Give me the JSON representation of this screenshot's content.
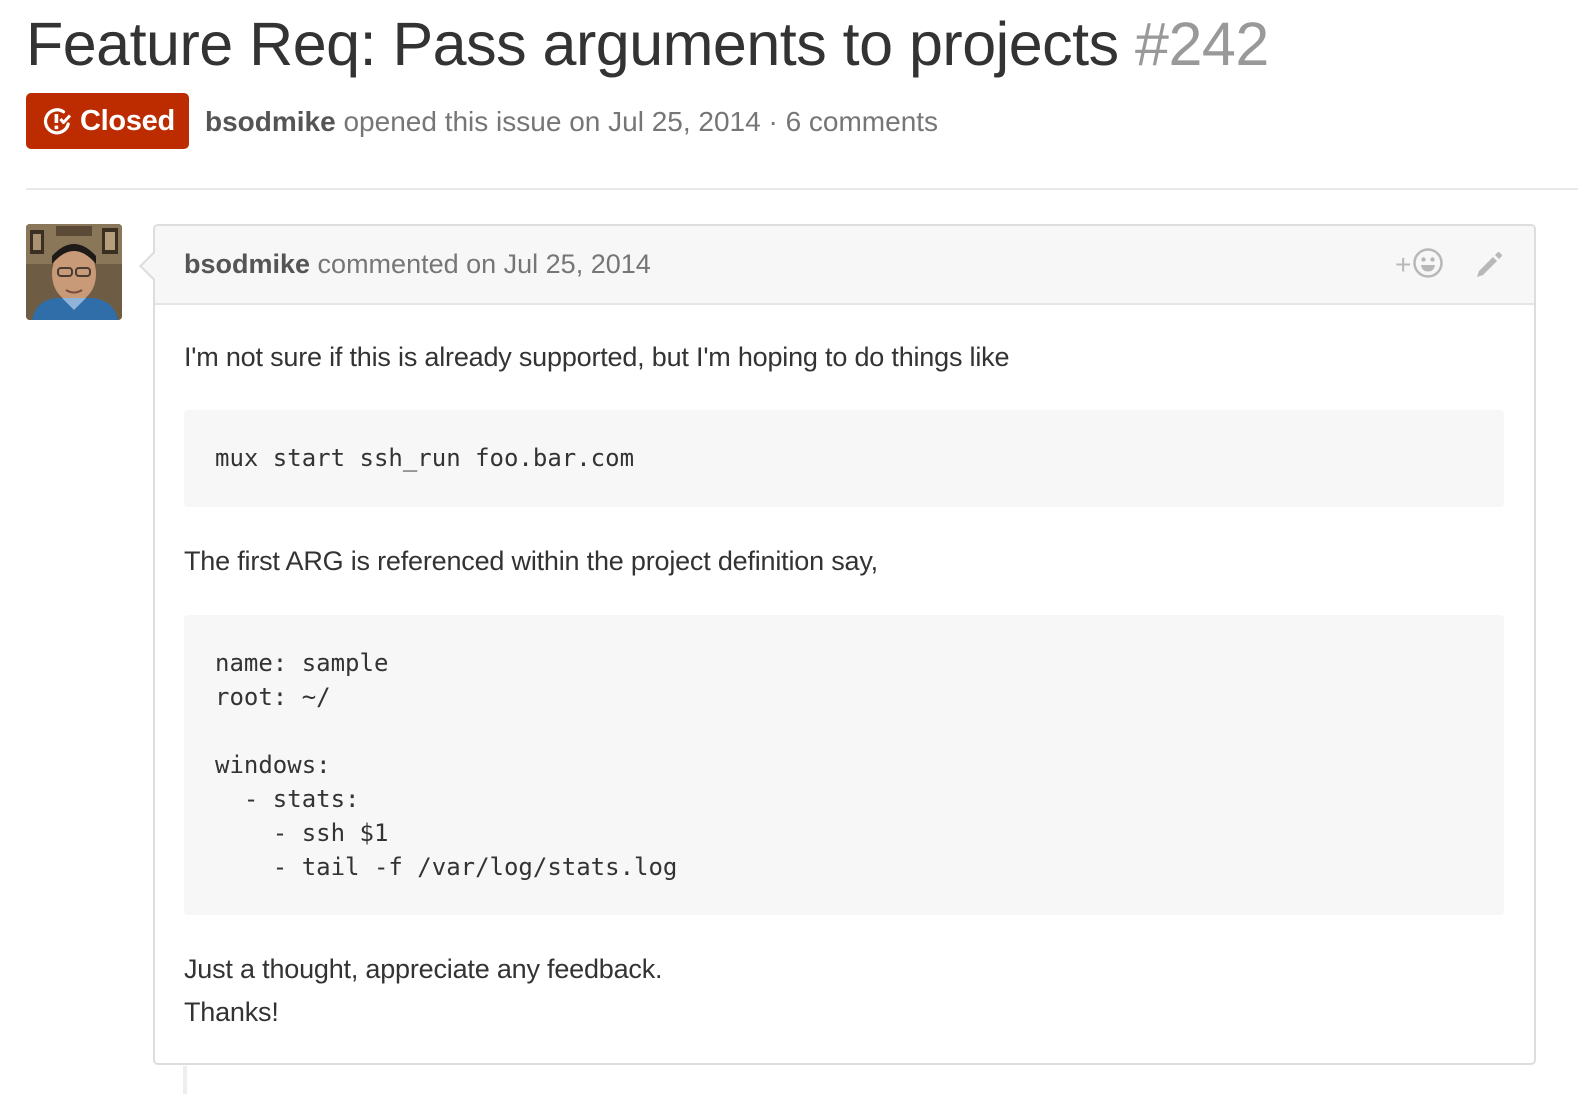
{
  "issue": {
    "title": "Feature Req: Pass arguments to projects",
    "number": "#242",
    "state": "Closed",
    "author": "bsodmike",
    "opened_text": " opened this issue on Jul 25, 2014 · 6 comments"
  },
  "colors": {
    "closed_badge": "#bd2c00",
    "code_background": "#f7f7f7",
    "header_background": "#f7f7f7"
  },
  "icons": {
    "state": "issue-closed-icon",
    "reaction": "smiley-icon",
    "edit": "pencil-icon"
  },
  "comment": {
    "author": "bsodmike",
    "header_text": " commented on Jul 25, 2014",
    "reaction_plus": "+",
    "body": {
      "para1": "I'm not sure if this is already supported, but I'm hoping to do things like",
      "code1": "mux start ssh_run foo.bar.com",
      "para2": "The first ARG is referenced within the project definition say,",
      "code2": "name: sample\nroot: ~/\n\nwindows:\n  - stats:\n    - ssh $1\n    - tail -f /var/log/stats.log",
      "para3": "Just a thought, appreciate any feedback.",
      "para4": "Thanks!"
    }
  }
}
